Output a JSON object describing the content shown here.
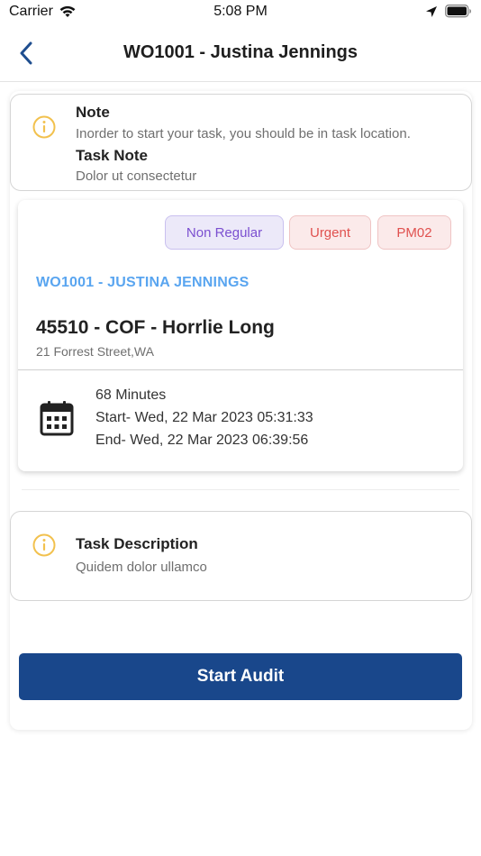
{
  "status_bar": {
    "carrier": "Carrier",
    "time": "5:08 PM"
  },
  "nav": {
    "title": "WO1001 - Justina Jennings",
    "back_icon": "chevron-left-icon"
  },
  "note_card": {
    "icon": "info-icon",
    "note_label": "Note",
    "note_text": "Inorder to start your task, you should be in task location.",
    "task_note_label": "Task Note",
    "task_note_text": "Dolor ut consectetur"
  },
  "work_order": {
    "badges": [
      {
        "label": "Non Regular",
        "color": "#7b4fd0"
      },
      {
        "label": "Urgent",
        "color": "#e0514f"
      },
      {
        "label": "PM02",
        "color": "#e0514f"
      }
    ],
    "header": "WO1001 - JUSTINA JENNINGS",
    "site_title": "45510 - COF - Horrlie Long",
    "address": "21 Forrest Street,WA",
    "duration": "68 Minutes",
    "start": "Start- Wed, 22 Mar 2023 05:31:33",
    "end": "End- Wed, 22 Mar 2023 06:39:56",
    "icon": "calendar-icon"
  },
  "description_card": {
    "icon": "info-icon",
    "label": "Task Description",
    "text": "Quidem dolor ullamco"
  },
  "actions": {
    "start_audit_label": "Start Audit"
  },
  "colors": {
    "primary": "#19478b",
    "header_blue": "#59a5f0",
    "info_yellow": "#f2c14e"
  }
}
